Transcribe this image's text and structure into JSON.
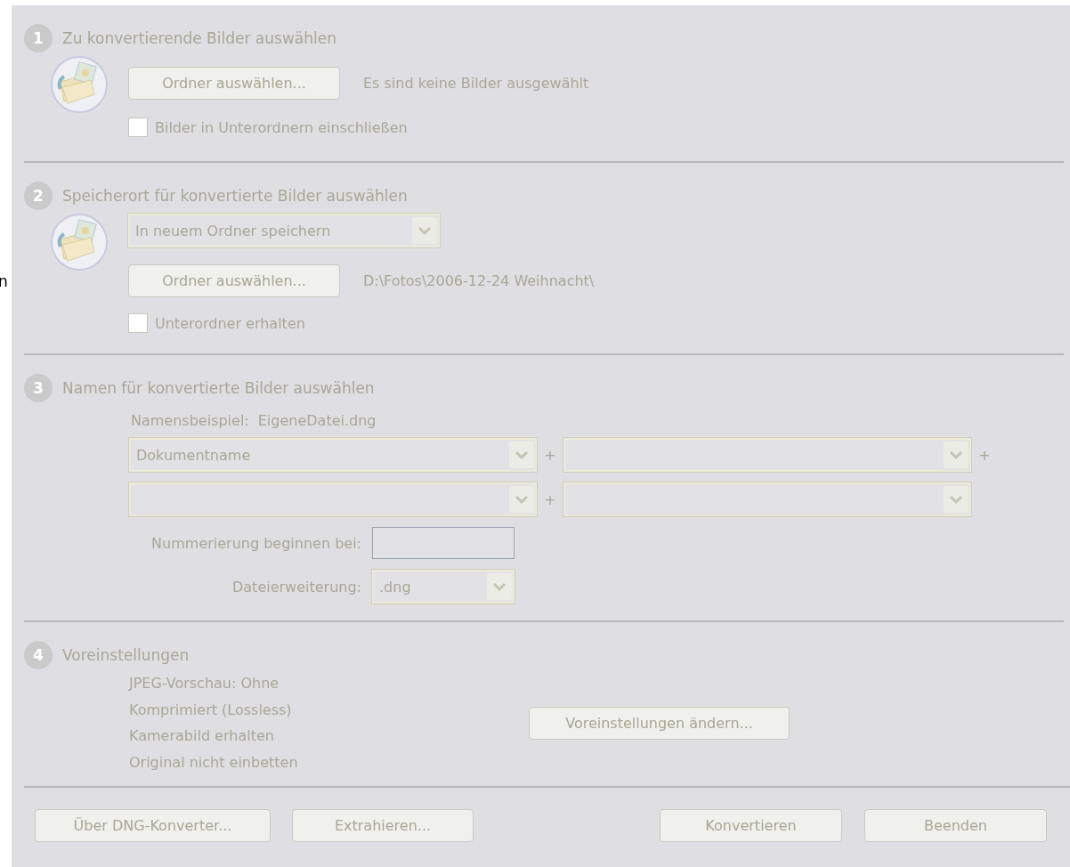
{
  "disabled": true,
  "edge_fragment": "n",
  "select_images": {
    "number": "1",
    "title": "Zu konvertierende Bilder auswählen",
    "button": "Ordner auswählen...",
    "status": "Es sind keine Bilder ausgewählt",
    "checkbox": {
      "label": "Bilder in Unterordnern einschließen",
      "checked": false
    }
  },
  "save_location": {
    "number": "2",
    "title": "Speicherort für konvertierte Bilder auswählen",
    "dropdown": "In neuem Ordner speichern",
    "button": "Ordner auswählen...",
    "path": "D:\\Fotos\\2006-12-24 Weihnacht\\",
    "checkbox": {
      "label": "Unterordner erhalten",
      "checked": false
    }
  },
  "naming": {
    "number": "3",
    "title": "Namen für konvertierte Bilder auswählen",
    "example_label": "Namensbeispiel:",
    "example_value": "EigeneDatei.dng",
    "name_rows": [
      {
        "first_value": "Dokumentname",
        "plus_signs": [
          "+",
          "+"
        ]
      },
      {
        "plus_signs": [
          "+"
        ]
      }
    ],
    "numbering_label": "Nummerierung beginnen bei:",
    "extension_label": "Dateierweiterung:",
    "extension": ".dng"
  },
  "preferences": {
    "number": "4",
    "title": "Voreinstellungen",
    "lines": [
      "JPEG-Vorschau: Ohne",
      "Komprimiert (Lossless)",
      "Kamerabild erhalten",
      "Original nicht einbetten"
    ],
    "button": "Voreinstellungen ändern..."
  },
  "footer": {
    "left": [
      "Über DNG-Konverter...",
      "Extrahieren..."
    ],
    "right": [
      "Konvertieren",
      "Beenden"
    ]
  }
}
